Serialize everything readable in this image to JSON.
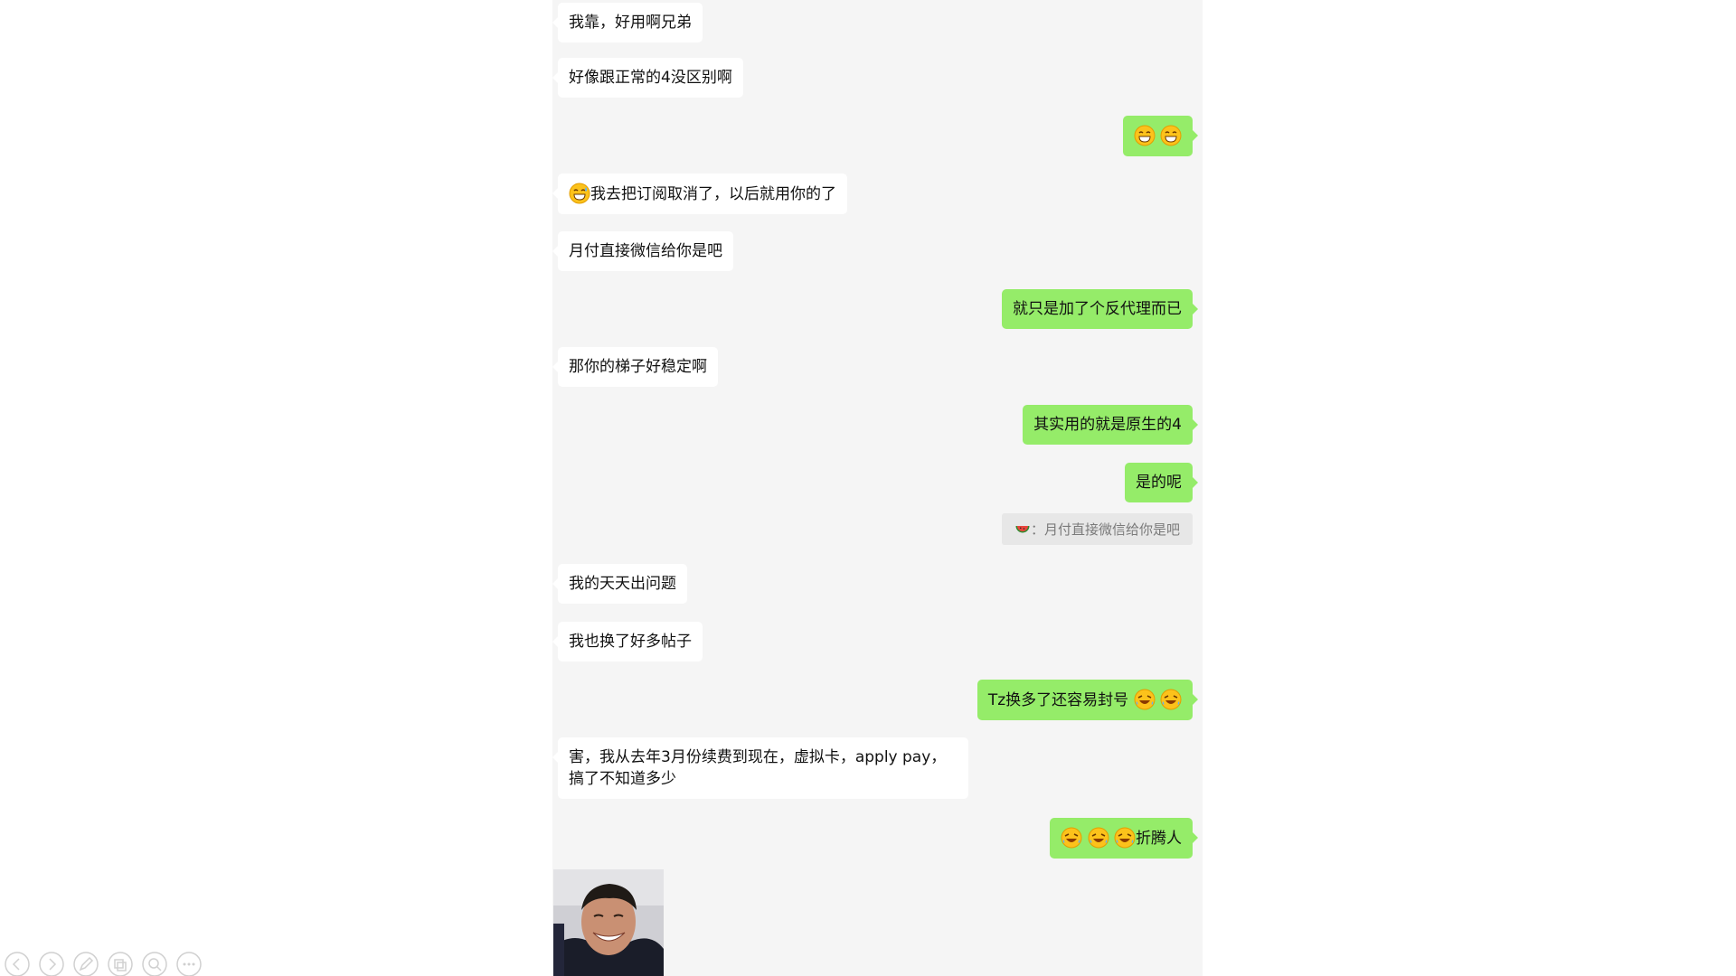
{
  "messages": [
    {
      "side": "in",
      "text": "我靠，好用啊兄弟"
    },
    {
      "side": "in",
      "text": "好像跟正常的4没区别啊"
    },
    {
      "side": "out",
      "emojis": [
        "grin-emoji",
        "grin-emoji"
      ],
      "text": ""
    },
    {
      "side": "in",
      "prefix_emoji": "laugh-sweat-emoji",
      "text": "我去把订阅取消了，以后就用你的了"
    },
    {
      "side": "in",
      "text": "月付直接微信给你是吧"
    },
    {
      "side": "out",
      "text": "就只是加了个反代理而已"
    },
    {
      "side": "in",
      "text": "那你的梯子好稳定啊"
    },
    {
      "side": "out",
      "text": "其实用的就是原生的4"
    },
    {
      "side": "out",
      "text": "是的呢"
    },
    {
      "side": "quote",
      "text": "：月付直接微信给你是吧",
      "quote_icon": "watermelon-icon"
    },
    {
      "side": "in",
      "text": "我的天天出问题"
    },
    {
      "side": "in",
      "text": "我也换了好多帖子"
    },
    {
      "side": "out",
      "text": "Tz换多了还容易封号",
      "suffix_emojis": [
        "rofl-emoji",
        "rofl-emoji"
      ]
    },
    {
      "side": "in",
      "text": "害，我从去年3月份续费到现在，虚拟卡，apply pay，搞了不知道多少"
    },
    {
      "side": "out",
      "prefix_emojis": [
        "rofl-emoji",
        "rofl-emoji",
        "rofl-emoji"
      ],
      "text": "折腾人"
    }
  ],
  "photo": {
    "subject": "smiling-man-photo"
  },
  "toolbar": {
    "icons": [
      "previous-icon",
      "next-icon",
      "pen-icon",
      "slides-icon",
      "zoom-icon",
      "more-icon"
    ]
  }
}
